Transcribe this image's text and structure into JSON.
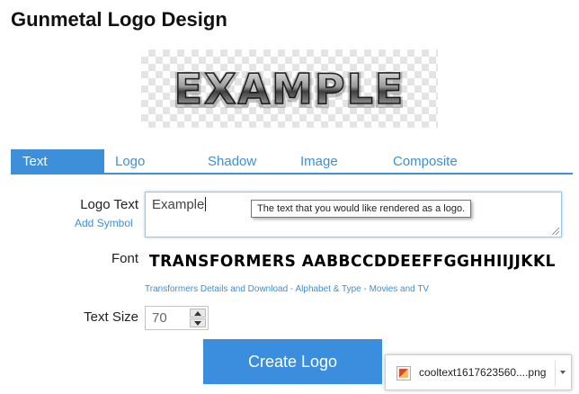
{
  "page": {
    "title": "Gunmetal Logo Design"
  },
  "preview": {
    "logo_text": "EXAMPLE"
  },
  "tabs": [
    {
      "label": "Text",
      "active": true
    },
    {
      "label": "Logo"
    },
    {
      "label": "Shadow"
    },
    {
      "label": "Image"
    },
    {
      "label": "Composite"
    }
  ],
  "form": {
    "logo_text_label": "Logo Text",
    "add_symbol_label": "Add Symbol",
    "logo_text_value": "Example",
    "tooltip": "The text that you would like rendered as a logo.",
    "font_label": "Font",
    "font_preview": "TRANSFORMERS  AABBCCDDEEFFGGHHIIJJKKL",
    "font_links": {
      "details": "Transformers Details and Download",
      "sep1": " - ",
      "category": "Alphabet & Type",
      "sep2": " - ",
      "sub": "Movies and TV"
    },
    "text_size_label": "Text Size",
    "text_size_value": "70",
    "create_button": "Create Logo"
  },
  "download_bar": {
    "filename": "cooltext1617623560....png"
  },
  "colors": {
    "accent": "#3c8fd8",
    "button": "#3b8ede"
  }
}
